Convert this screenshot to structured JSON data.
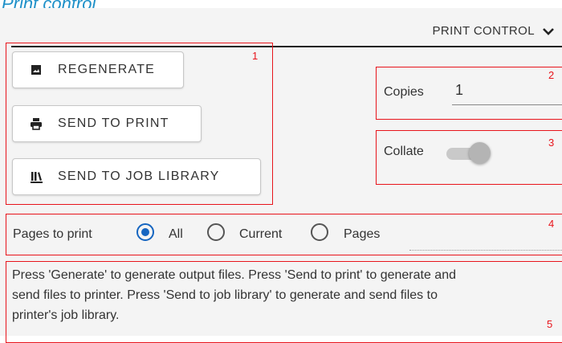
{
  "page_title": "Print control",
  "header": {
    "title": "PRINT CONTROL"
  },
  "sections": {
    "s1": "1",
    "s2": "2",
    "s3": "3",
    "s4": "4",
    "s5": "5"
  },
  "buttons": {
    "regenerate": "REGENERATE",
    "send_to_print": "SEND TO PRINT",
    "send_to_job_library": "SEND TO JOB LIBRARY"
  },
  "copies": {
    "label": "Copies",
    "value": "1"
  },
  "collate": {
    "label": "Collate",
    "on": false
  },
  "pages_to_print": {
    "label": "Pages to print",
    "options": [
      "All",
      "Current",
      "Pages"
    ],
    "selected": "All"
  },
  "info": {
    "line1": "Press 'Generate' to generate output files. Press 'Send to print' to generate and",
    "line2": "send files to printer. Press 'Send to job library' to generate and send files to",
    "line3": "printer's job library."
  },
  "colors": {
    "accent": "#1565c0",
    "annotation": "#e8141b",
    "title": "#1e90c8"
  },
  "icons": {
    "regenerate": "image-icon",
    "send_to_print": "printer-icon",
    "send_to_job_library": "library-icon",
    "header": "chevron-down-icon"
  }
}
